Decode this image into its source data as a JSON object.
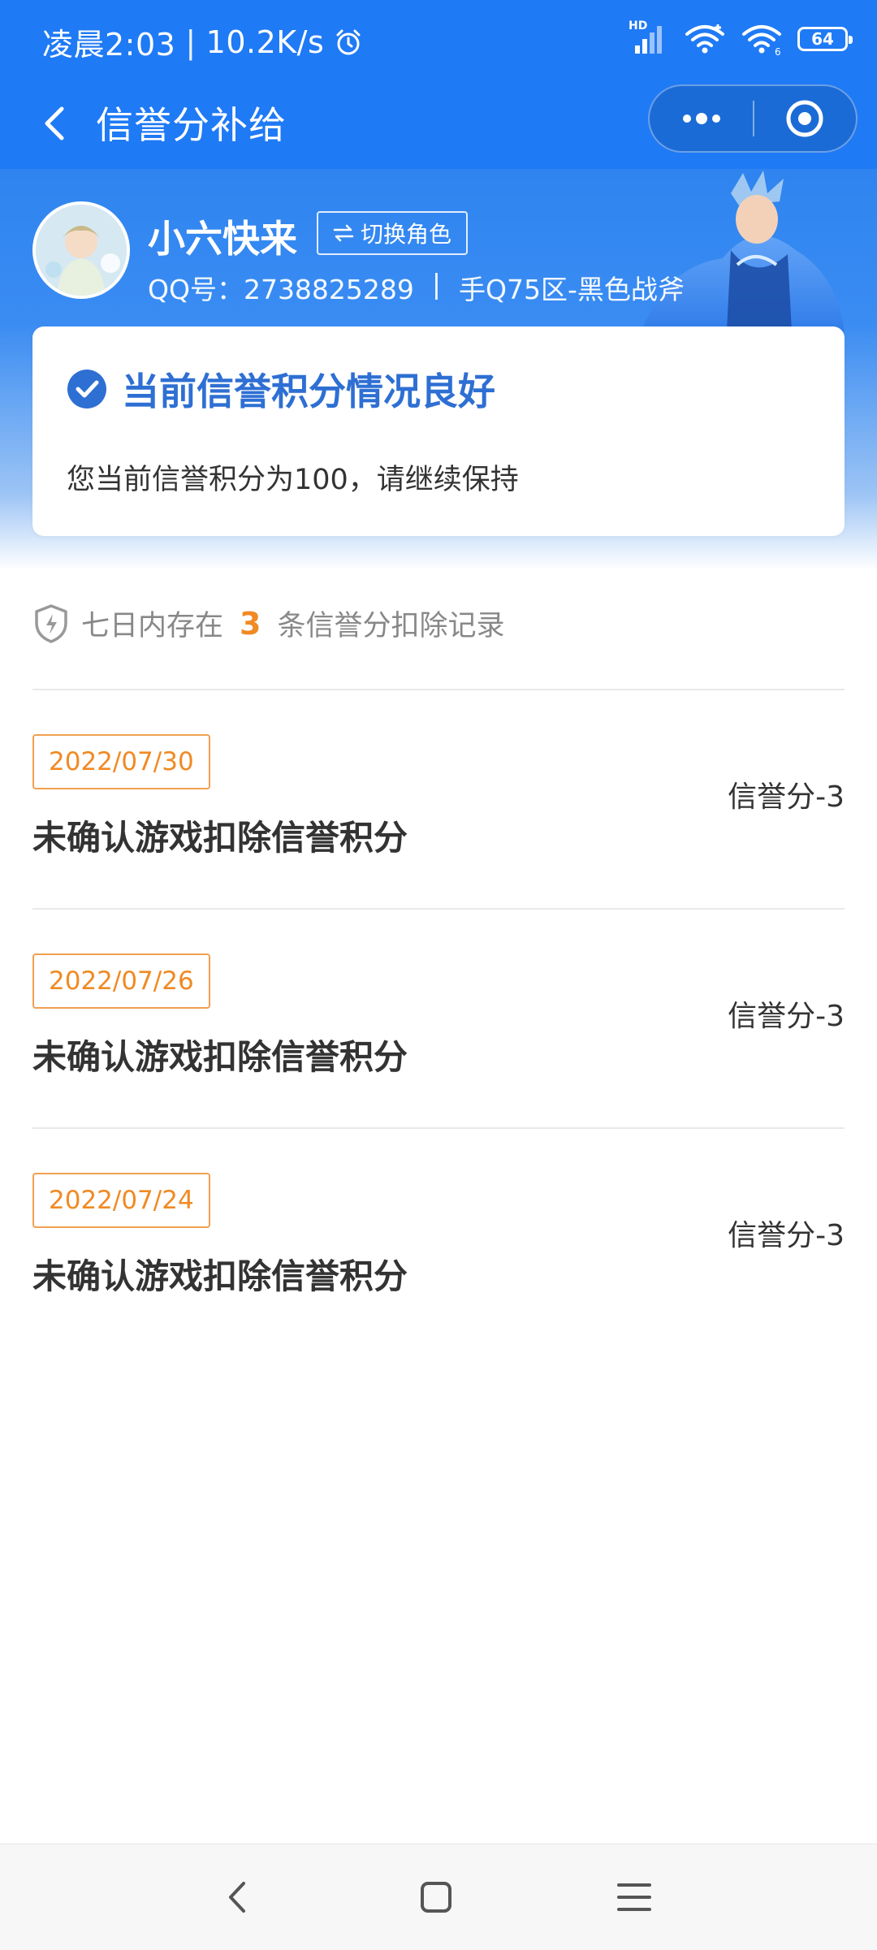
{
  "status_bar": {
    "time": "凌晨2:03",
    "speed": "10.2K/s",
    "hd_label": "HD",
    "battery": "64",
    "icons": [
      "alarm-icon",
      "signal-icon",
      "wifi-icon",
      "wifi-hotspot-icon",
      "battery-icon"
    ]
  },
  "title_bar": {
    "title": "信誉分补给",
    "back_icon": "chevron-left-icon",
    "more_icon": "more-dots-icon",
    "close_icon": "target-circle-icon"
  },
  "profile": {
    "nickname": "小六快来",
    "switch_role_label": "切换角色",
    "qq_label": "QQ号：2738825289",
    "separator": "|",
    "server_info": "手Q75区-黑色战斧"
  },
  "status_card": {
    "title": "当前信誉积分情况良好",
    "description": "您当前信誉积分为100，请继续保持"
  },
  "summary": {
    "prefix": "七日内存在",
    "count": "3",
    "suffix": "条信誉分扣除记录"
  },
  "records": [
    {
      "date": "2022/07/30",
      "title": "未确认游戏扣除信誉积分",
      "score": "信誉分-3"
    },
    {
      "date": "2022/07/26",
      "title": "未确认游戏扣除信誉积分",
      "score": "信誉分-3"
    },
    {
      "date": "2022/07/24",
      "title": "未确认游戏扣除信誉积分",
      "score": "信誉分-3"
    }
  ],
  "colors": {
    "primary_blue": "#1f7af5",
    "card_title_blue": "#2e6fd3",
    "accent_orange": "#f08a24"
  }
}
